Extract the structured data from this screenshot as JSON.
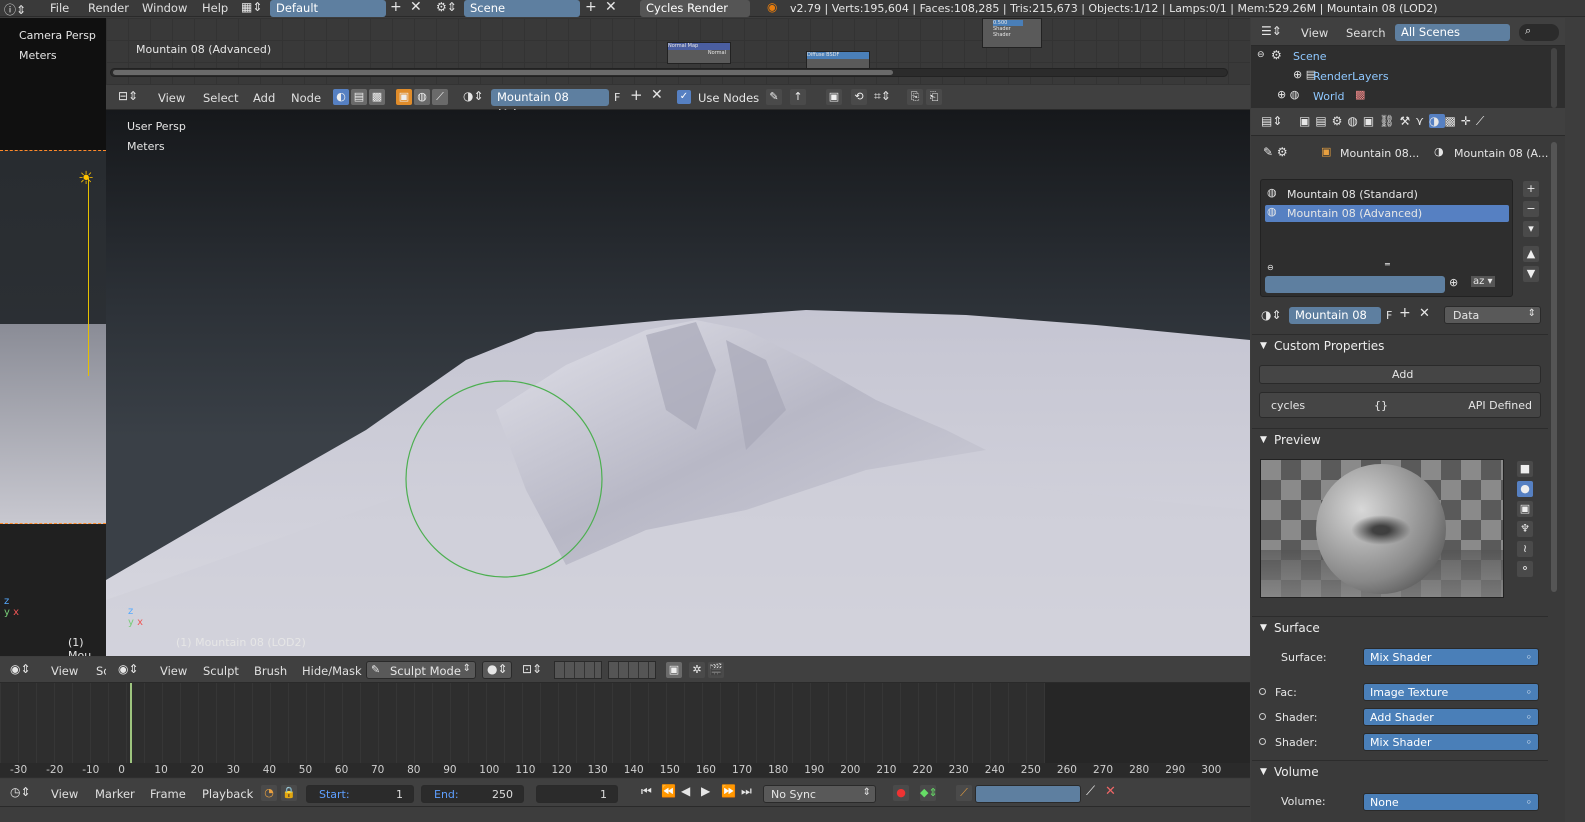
{
  "topbar": {
    "menus": [
      "File",
      "Render",
      "Window",
      "Help"
    ],
    "layout": "Default",
    "scene": "Scene",
    "engine": "Cycles Render",
    "stats": "v2.79 | Verts:195,604 | Faces:108,285 | Tris:215,673 | Objects:1/12 | Lamps:0/1 | Mem:529.26M | Mountain 08 (LOD2)"
  },
  "left_view": {
    "title": "Camera Persp",
    "units": "Meters",
    "object": "(1) Mou"
  },
  "node_editor": {
    "label": "Mountain 08 (Advanced)",
    "menus": [
      "View",
      "Select",
      "Add",
      "Node"
    ],
    "material": "Mountain 08 (Adva...",
    "f_label": "F",
    "use_nodes": "Use Nodes",
    "mini_nodes": [
      "Normal Map",
      "Normal",
      "Diffuse BSDF",
      "Shader",
      "Shader",
      "0.500"
    ]
  },
  "viewport": {
    "title": "User Persp",
    "units": "Meters",
    "object": "(1) Mountain 08 (LOD2)",
    "menus": [
      "View",
      "Sculpt",
      "Brush",
      "Hide/Mask"
    ],
    "mode": "Sculpt Mode",
    "left_menus": [
      "View",
      "Sc"
    ]
  },
  "timeline": {
    "ticks": [
      "-30",
      "-20",
      "-10",
      "0",
      "10",
      "20",
      "30",
      "40",
      "50",
      "60",
      "70",
      "80",
      "90",
      "100",
      "110",
      "120",
      "130",
      "140",
      "150",
      "160",
      "170",
      "180",
      "190",
      "200",
      "210",
      "220",
      "230",
      "240",
      "250",
      "260",
      "270",
      "280",
      "290",
      "300"
    ],
    "menus": [
      "View",
      "Marker",
      "Frame",
      "Playback"
    ],
    "start_label": "Start:",
    "start": "1",
    "end_label": "End:",
    "end": "250",
    "current": "1",
    "sync": "No Sync"
  },
  "outliner": {
    "menus": [
      "View",
      "Search"
    ],
    "filter": "All Scenes",
    "items": [
      "Scene",
      "RenderLayers",
      "World"
    ]
  },
  "properties": {
    "breadcrumb": [
      "Mountain 08...",
      "Mountain 08 (A..."
    ],
    "materials": [
      "Mountain 08 (Standard)",
      "Mountain 08 (Advanced)"
    ],
    "slot_name": "Mountain 08 ...",
    "slot_f": "F",
    "slot_mode": "Data",
    "custom_properties": {
      "title": "Custom Properties",
      "add": "Add",
      "key": "cycles",
      "value": "{}",
      "api": "API Defined"
    },
    "preview": {
      "title": "Preview"
    },
    "surface": {
      "title": "Surface",
      "rows": [
        {
          "label": "Surface:",
          "value": "Mix Shader"
        },
        {
          "label": "Fac:",
          "value": "Image Texture"
        },
        {
          "label": "Shader:",
          "value": "Add Shader"
        },
        {
          "label": "Shader:",
          "value": "Mix Shader"
        }
      ]
    },
    "volume": {
      "title": "Volume",
      "label": "Volume:",
      "value": "None"
    }
  }
}
